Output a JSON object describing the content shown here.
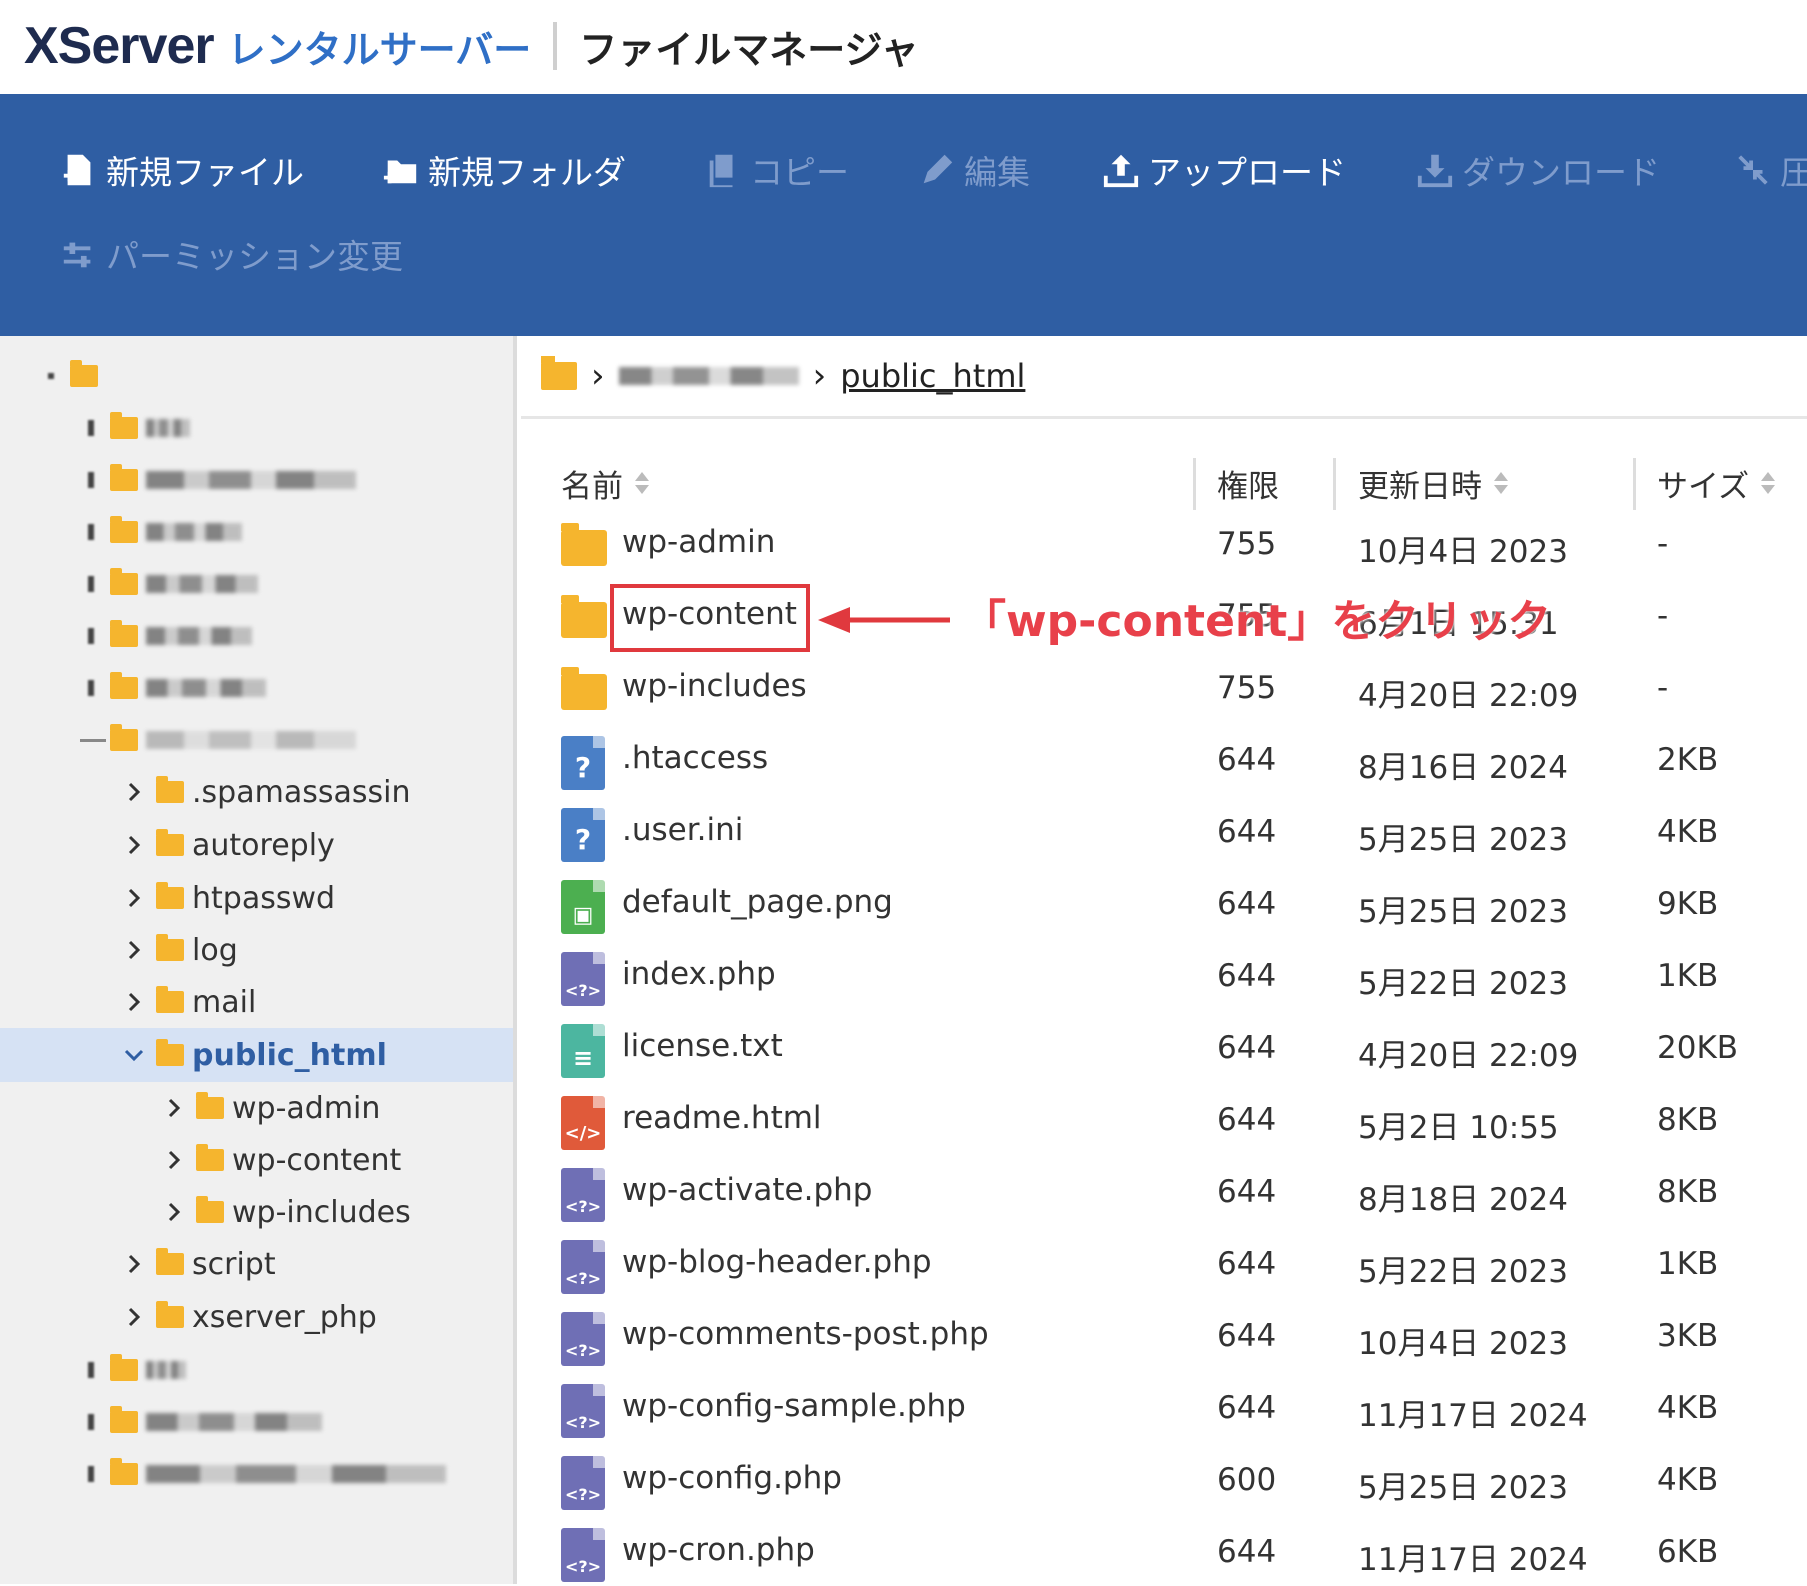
{
  "header": {
    "logo_x": "XServer",
    "logo_rental": "レンタルサーバー",
    "app_title": "ファイルマネージャ"
  },
  "toolbar": {
    "new_file": "新規ファイル",
    "new_folder": "新規フォルダ",
    "copy": "コピー",
    "edit": "編集",
    "upload": "アップロード",
    "download": "ダウンロード",
    "compress": "圧",
    "permission": "パーミッション変更"
  },
  "breadcrumb": {
    "current": "public_html"
  },
  "tree": {
    "items": [
      {
        "label": ".spamassassin"
      },
      {
        "label": "autoreply"
      },
      {
        "label": "htpasswd"
      },
      {
        "label": "log"
      },
      {
        "label": "mail"
      },
      {
        "label": "public_html"
      },
      {
        "label": "wp-admin"
      },
      {
        "label": "wp-content"
      },
      {
        "label": "wp-includes"
      },
      {
        "label": "script"
      },
      {
        "label": "xserver_php"
      }
    ]
  },
  "table": {
    "headers": {
      "name": "名前",
      "perm": "権限",
      "date": "更新日時",
      "size": "サイズ"
    },
    "rows": [
      {
        "name": "wp-admin",
        "perm": "755",
        "date": "10月4日 2023",
        "size": "-",
        "type": "folder"
      },
      {
        "name": "wp-content",
        "perm": "755",
        "date": "6月1日 15:31",
        "size": "-",
        "type": "folder"
      },
      {
        "name": "wp-includes",
        "perm": "755",
        "date": "4月20日 22:09",
        "size": "-",
        "type": "folder"
      },
      {
        "name": ".htaccess",
        "perm": "644",
        "date": "8月16日 2024",
        "size": "2KB",
        "type": "unknown"
      },
      {
        "name": ".user.ini",
        "perm": "644",
        "date": "5月25日 2023",
        "size": "4KB",
        "type": "unknown"
      },
      {
        "name": "default_page.png",
        "perm": "644",
        "date": "5月25日 2023",
        "size": "9KB",
        "type": "image"
      },
      {
        "name": "index.php",
        "perm": "644",
        "date": "5月22日 2023",
        "size": "1KB",
        "type": "php"
      },
      {
        "name": "license.txt",
        "perm": "644",
        "date": "4月20日 22:09",
        "size": "20KB",
        "type": "text"
      },
      {
        "name": "readme.html",
        "perm": "644",
        "date": "5月2日 10:55",
        "size": "8KB",
        "type": "html"
      },
      {
        "name": "wp-activate.php",
        "perm": "644",
        "date": "8月18日 2024",
        "size": "8KB",
        "type": "php"
      },
      {
        "name": "wp-blog-header.php",
        "perm": "644",
        "date": "5月22日 2023",
        "size": "1KB",
        "type": "php"
      },
      {
        "name": "wp-comments-post.php",
        "perm": "644",
        "date": "10月4日 2023",
        "size": "3KB",
        "type": "php"
      },
      {
        "name": "wp-config-sample.php",
        "perm": "644",
        "date": "11月17日 2024",
        "size": "4KB",
        "type": "php"
      },
      {
        "name": "wp-config.php",
        "perm": "600",
        "date": "5月25日 2023",
        "size": "4KB",
        "type": "php"
      },
      {
        "name": "wp-cron.php",
        "perm": "644",
        "date": "11月17日 2024",
        "size": "6KB",
        "type": "php"
      }
    ]
  },
  "annotation": {
    "text": "「wp-content」をクリック"
  },
  "colors": {
    "toolbar_bg": "#2f5ea3",
    "folder": "#f5b52e",
    "annotation": "#e0393e",
    "selected_bg": "#d6e2f4"
  }
}
